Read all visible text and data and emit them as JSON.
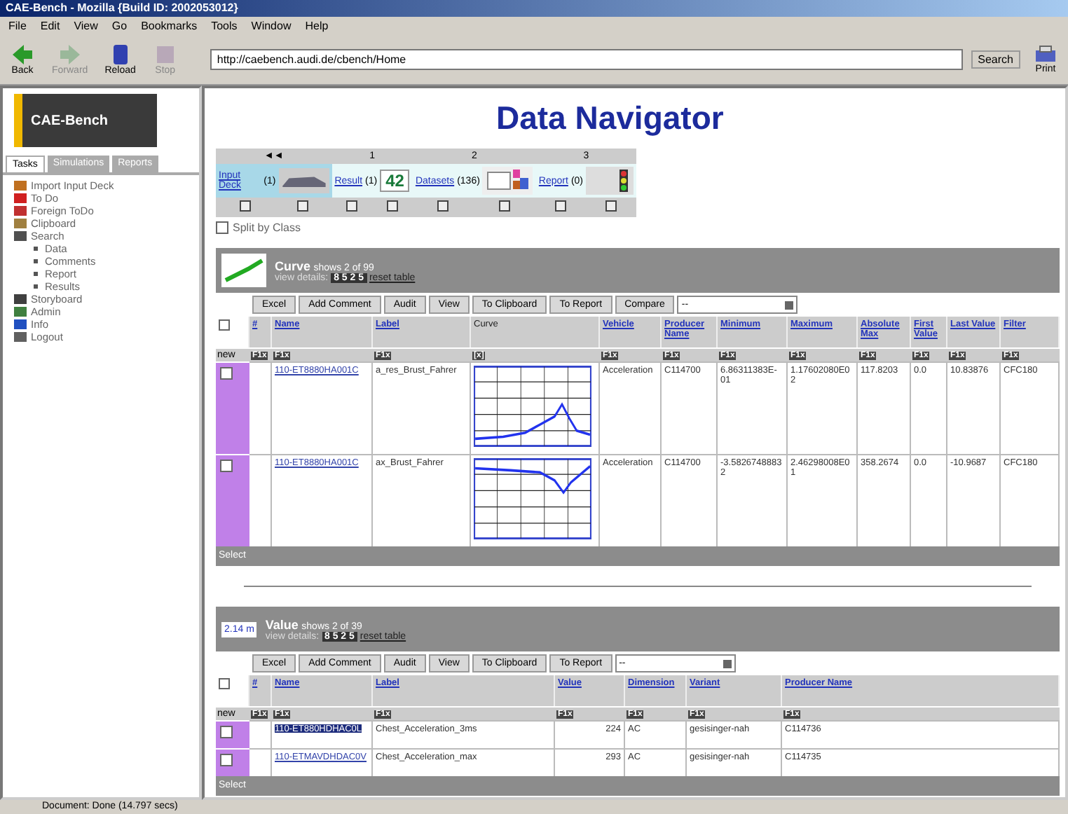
{
  "window": {
    "title": "CAE-Bench - Mozilla {Build ID: 2002053012}"
  },
  "menu": [
    "File",
    "Edit",
    "View",
    "Go",
    "Bookmarks",
    "Tools",
    "Window",
    "Help"
  ],
  "toolbar": {
    "buttons": [
      {
        "label": "Back",
        "kind": "back",
        "disabled": false
      },
      {
        "label": "Forward",
        "kind": "forward",
        "disabled": true
      },
      {
        "label": "Reload",
        "kind": "reload",
        "disabled": false
      },
      {
        "label": "Stop",
        "kind": "stop",
        "disabled": true
      }
    ],
    "url": "http://caebench.audi.de/cbench/Home",
    "search": "Search",
    "print": "Print"
  },
  "sidebar": {
    "logo": "CAE-Bench",
    "tabs": [
      {
        "label": "Tasks",
        "selected": true
      },
      {
        "label": "Simulations",
        "selected": false
      },
      {
        "label": "Reports",
        "selected": false
      }
    ],
    "items": [
      {
        "label": "Import Input Deck",
        "color": "#c07020"
      },
      {
        "label": "To Do",
        "color": "#d02020"
      },
      {
        "label": "Foreign ToDo",
        "color": "#c03030"
      },
      {
        "label": "Clipboard",
        "color": "#a08040"
      },
      {
        "label": "Search",
        "color": "#505050",
        "children": [
          {
            "label": "Data"
          },
          {
            "label": "Comments"
          },
          {
            "label": "Report"
          },
          {
            "label": "Results"
          }
        ]
      },
      {
        "label": "Storyboard",
        "color": "#404040"
      },
      {
        "label": "Admin",
        "color": "#408040"
      },
      {
        "label": "Info",
        "color": "#2050c0"
      },
      {
        "label": "Logout",
        "color": "#606060"
      }
    ]
  },
  "main": {
    "title": "Data Navigator",
    "navigator": {
      "steps": [
        {
          "label": "◄◄",
          "kind": "car",
          "link": "Input Deck",
          "count": "(1)",
          "selected": true
        },
        {
          "label": "1",
          "kind": "number",
          "link": "Result",
          "count": "(1)",
          "thumb_text": "42",
          "selected": false
        },
        {
          "label": "2",
          "kind": "chart",
          "link": "Datasets",
          "count": "(136)",
          "selected": false
        },
        {
          "label": "3",
          "kind": "light",
          "link": "Report",
          "count": "(0)",
          "selected": false
        }
      ],
      "split_label": "Split by Class",
      "split_checked": false
    },
    "sections": [
      {
        "title": "Curve",
        "shows": "shows 2 of 99",
        "kind": "curve",
        "view_label": "view details:",
        "pages": "8 5 2 5",
        "reset": "reset table",
        "buttons": [
          "Excel",
          "Add Comment",
          "Audit",
          "View",
          "To Clipboard",
          "To Report",
          "Compare"
        ],
        "select": "--",
        "filter_label": "new",
        "filters": [
          "F1x",
          "F1x",
          "F1x",
          "[x]",
          "F1x",
          "F1x",
          "F1x",
          "F1x",
          "F1x",
          "F1x",
          "F1x",
          "F1x"
        ],
        "columns": [
          "#",
          "Name",
          "Label",
          "Curve",
          "Vehicle",
          "Producer Name",
          "Minimum",
          "Maximum",
          "Absolute Max",
          "First Value",
          "Last Value",
          "Filter"
        ],
        "rows": [
          {
            "selected": false,
            "checked": false,
            "cells": [
              "",
              "110-ET8880HA001C",
              "a_res_Brust_Fahrer",
              "",
              "Acceleration",
              "C114700",
              "6.86311383E-01",
              "1.17602080E02",
              "117.8203",
              "0.0",
              "10.83876",
              "CFC180"
            ]
          },
          {
            "selected": false,
            "checked": false,
            "cells": [
              "",
              "110-ET8880HA001C",
              "ax_Brust_Fahrer",
              "",
              "Acceleration",
              "C114700",
              "-3.58267488832",
              "2.46298008E01",
              "358.2674",
              "0.0",
              "-10.9687",
              "CFC180"
            ]
          }
        ],
        "footer": "Select"
      },
      {
        "title": "Value",
        "shows": "shows 2 of 39",
        "kind": "value",
        "icon_text": "2.14 m",
        "view_label": "view details:",
        "pages": "8 5 2 5",
        "reset": "reset table",
        "buttons": [
          "Excel",
          "Add Comment",
          "Audit",
          "View",
          "To Clipboard",
          "To Report"
        ],
        "select": "--",
        "filter_label": "new",
        "filters": [
          "F1x",
          "F1x",
          "F1x",
          "F1x",
          "F1x",
          "F1x",
          "F1x"
        ],
        "columns": [
          "#",
          "Name",
          "Label",
          "Value",
          "Dimension",
          "Variant",
          "Producer Name"
        ],
        "rows": [
          {
            "selected": true,
            "checked": false,
            "cells": [
              "",
              "110-ET880HDHAC0L",
              "Chest_Acceleration_3ms",
              "224",
              "AC",
              "gesisinger-nah",
              "C114736"
            ]
          },
          {
            "selected": false,
            "checked": false,
            "cells": [
              "",
              "110-ETMAVDHDAC0V",
              "Chest_Acceleration_max",
              "293",
              "AC",
              "gesisinger-nah",
              "C114735"
            ]
          }
        ],
        "footer": "Select"
      }
    ]
  },
  "status_bar": "Document: Done (14.797 secs)"
}
